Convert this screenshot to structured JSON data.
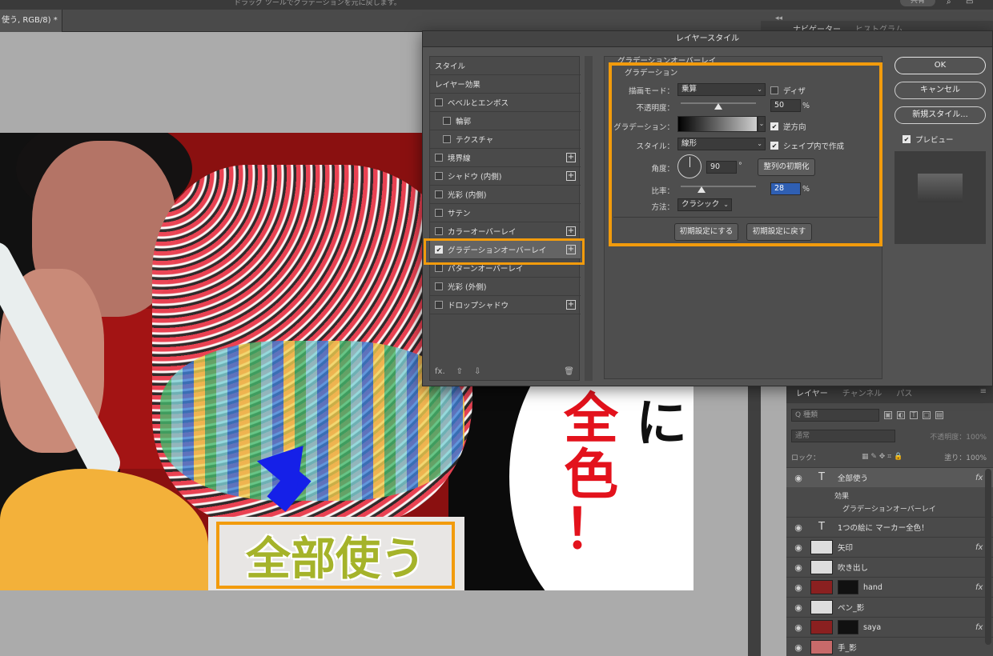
{
  "app": {
    "top_hint": "ドラッグ ツールでグラデーションを元に戻します。",
    "share_label": "共有",
    "doc_tab_label": "使う, RGB/8) *",
    "collapse_glyph": "◂◂",
    "panel_tabs": [
      "ナビゲーター",
      "ヒストグラム"
    ]
  },
  "canvas": {
    "caption_zenbu": "全部使う",
    "big_red_1": "全",
    "big_red_2": "色",
    "big_red_3": "！",
    "big_black": "に",
    "accent_orange": "#f29b0c"
  },
  "dialog": {
    "title": "レイヤースタイル",
    "styles": [
      {
        "label": "スタイル",
        "checkbox": false,
        "plus": false,
        "indent": false
      },
      {
        "label": "レイヤー効果",
        "checkbox": false,
        "plus": false,
        "indent": false
      },
      {
        "label": "ベベルとエンボス",
        "checkbox": true,
        "checked": false,
        "plus": false,
        "indent": false
      },
      {
        "label": "輪郭",
        "checkbox": true,
        "checked": false,
        "plus": false,
        "indent": true
      },
      {
        "label": "テクスチャ",
        "checkbox": true,
        "checked": false,
        "plus": false,
        "indent": true
      },
      {
        "label": "境界線",
        "checkbox": true,
        "checked": false,
        "plus": true,
        "indent": false
      },
      {
        "label": "シャドウ (内側)",
        "checkbox": true,
        "checked": false,
        "plus": true,
        "indent": false
      },
      {
        "label": "光彩 (内側)",
        "checkbox": true,
        "checked": false,
        "plus": false,
        "indent": false
      },
      {
        "label": "サテン",
        "checkbox": true,
        "checked": false,
        "plus": false,
        "indent": false
      },
      {
        "label": "カラーオーバーレイ",
        "checkbox": true,
        "checked": false,
        "plus": true,
        "indent": false
      },
      {
        "label": "グラデーションオーバーレイ",
        "checkbox": true,
        "checked": true,
        "plus": true,
        "indent": false,
        "selected": true
      },
      {
        "label": "パターンオーバーレイ",
        "checkbox": true,
        "checked": false,
        "plus": false,
        "indent": false
      },
      {
        "label": "光彩 (外側)",
        "checkbox": true,
        "checked": false,
        "plus": false,
        "indent": false
      },
      {
        "label": "ドロップシャドウ",
        "checkbox": true,
        "checked": false,
        "plus": true,
        "indent": false
      }
    ],
    "footer": {
      "fx": "fx.",
      "up": "⇧",
      "down": "⇩",
      "trash": "🗑"
    },
    "section_title": "グラデーションオーバーレイ",
    "group_title": "グラデーション",
    "blend_mode": {
      "label": "描画モード：",
      "value": "乗算"
    },
    "dither": {
      "label": "ディザ",
      "checked": false
    },
    "opacity": {
      "label": "不透明度：",
      "value": "50",
      "unit": "%",
      "fraction": 0.5
    },
    "gradient": {
      "label": "グラデーション："
    },
    "reverse": {
      "label": "逆方向",
      "checked": true
    },
    "style": {
      "label": "スタイル：",
      "value": "線形"
    },
    "align_shape": {
      "label": "シェイプ内で作成",
      "checked": true
    },
    "angle": {
      "label": "角度：",
      "value": "90",
      "unit": "°"
    },
    "reset_align": "整列の初期化",
    "scale": {
      "label": "比率：",
      "value": "28",
      "unit": "%",
      "fraction": 0.28
    },
    "method": {
      "label": "方法：",
      "value": "クラシック"
    },
    "make_default": "初期設定にする",
    "reset_default": "初期設定に戻す",
    "ok": "OK",
    "cancel": "キャンセル",
    "new_style": "新規スタイル...",
    "preview": {
      "label": "プレビュー",
      "checked": true
    }
  },
  "layers_panel": {
    "tabs": [
      "レイヤー",
      "チャンネル",
      "パス"
    ],
    "kind_placeholder": "Q 種類",
    "blend": "通常",
    "opacity_label": "不透明度：100%",
    "lock_label": "ロック：",
    "fill_label": "塗り：100%",
    "layers": [
      {
        "name": "全部使う",
        "type": "text",
        "fx": true,
        "selected": true
      },
      {
        "name": "1つの絵に マーカー全色！",
        "type": "text",
        "fx": false
      },
      {
        "name": "矢印",
        "type": "image",
        "fx": true
      },
      {
        "name": "吹き出し",
        "type": "image",
        "fx": false
      },
      {
        "name": "hand",
        "type": "image",
        "fx": true
      },
      {
        "name": "ペン_影",
        "type": "image",
        "fx": false
      },
      {
        "name": "saya",
        "type": "image",
        "fx": true
      },
      {
        "name": "手_影",
        "type": "image",
        "fx": false
      }
    ],
    "effects_label": "効果",
    "effect_item": "グラデーションオーバーレイ"
  }
}
